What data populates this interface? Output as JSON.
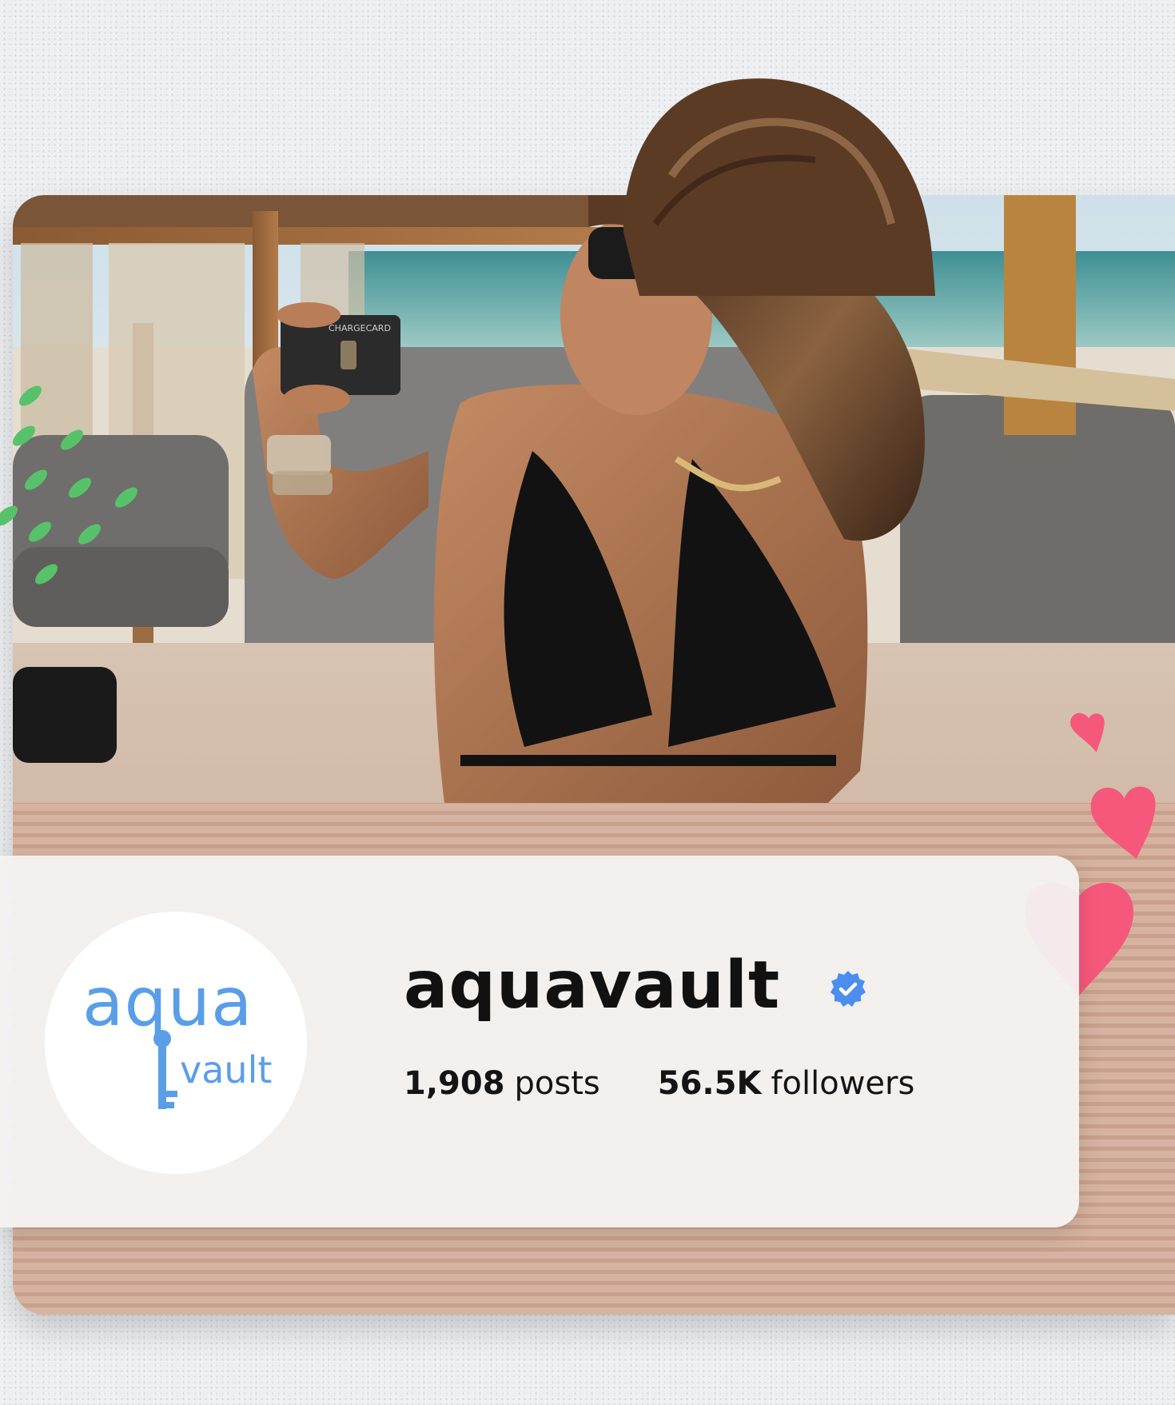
{
  "profile": {
    "username": "aquavault",
    "verified": true,
    "posts_count": "1,908",
    "posts_label": "posts",
    "followers_count": "56.5K",
    "followers_label": "followers",
    "avatar_logo": {
      "line1": "aqua",
      "line2": "vault"
    }
  },
  "photo": {
    "card_label": "CHARGECARD"
  },
  "colors": {
    "background": "#eceef1",
    "card_background": "#f4f3f2",
    "logo_blue": "#5a9ee8",
    "verified_blue": "#4b8ef0",
    "heart_pink": "#f5587a",
    "dash_green": "#57c26a"
  },
  "icons": {
    "verified": "verified-badge-icon",
    "decor_hearts": "heart-icon",
    "decor_dashes": "green-dash-decoration"
  }
}
